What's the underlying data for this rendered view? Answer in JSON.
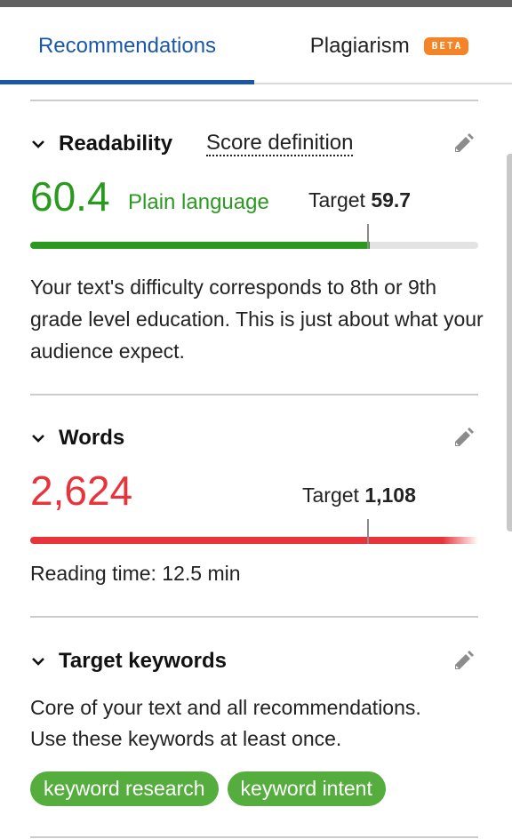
{
  "tabs": [
    {
      "label": "Recommendations",
      "active": true
    },
    {
      "label": "Plagiarism",
      "active": false,
      "badge": "BETA"
    }
  ],
  "colors": {
    "accent_blue": "#1b57a8",
    "good_green": "#2a9a1f",
    "bad_red": "#e8333a",
    "badge_orange": "#f58426",
    "pill_green": "#55ad3e"
  },
  "readability": {
    "title": "Readability",
    "score_definition_link": "Score definition",
    "score": "60.4",
    "score_label": "Plain language",
    "target_label": "Target",
    "target_value": "59.7",
    "progress_fraction": 0.758,
    "target_marker_fraction": 0.752,
    "description": "Your text's difficulty corresponds to 8th or 9th grade level education. This is just about what your audience expect.",
    "icons": {
      "collapse": "chevron-down-icon",
      "edit": "pencil-icon"
    }
  },
  "words": {
    "title": "Words",
    "count": "2,624",
    "target_label": "Target",
    "target_value": "1,108",
    "progress_fraction": 1.0,
    "target_marker_fraction": 0.752,
    "reading_time": "Reading time: 12.5 min",
    "icons": {
      "collapse": "chevron-down-icon",
      "edit": "pencil-icon"
    }
  },
  "target_keywords": {
    "title": "Target keywords",
    "description_line1": "Core of your text and all recommendations.",
    "description_line2": "Use these keywords at least once.",
    "keywords": [
      "keyword research",
      "keyword intent"
    ],
    "icons": {
      "collapse": "chevron-down-icon",
      "edit": "pencil-icon"
    }
  }
}
